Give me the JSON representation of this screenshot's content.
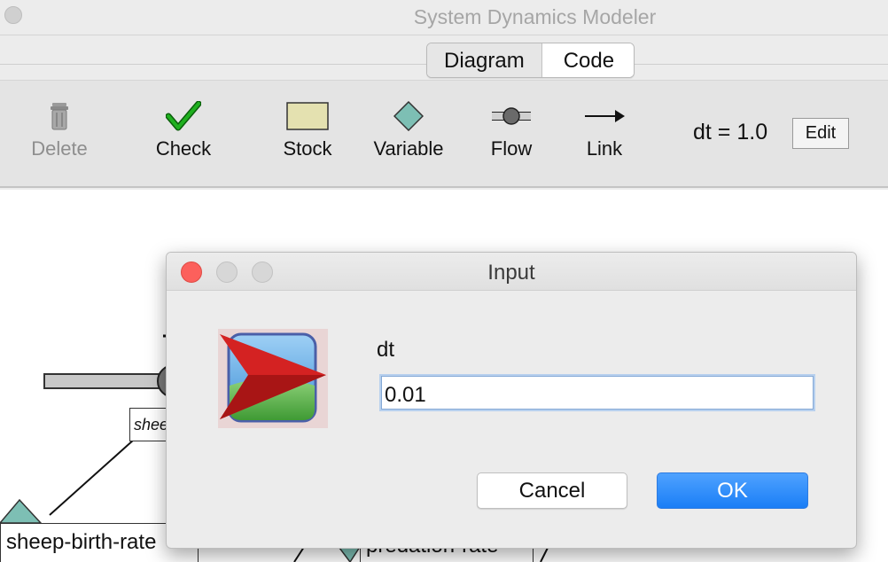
{
  "window": {
    "title": "System Dynamics Modeler"
  },
  "tabs": [
    {
      "label": "Diagram",
      "selected": true
    },
    {
      "label": "Code",
      "selected": false
    }
  ],
  "toolbar": {
    "tools": [
      {
        "label": "Delete",
        "icon": "trash-icon",
        "enabled": false
      },
      {
        "label": "Check",
        "icon": "checkmark-icon",
        "enabled": true
      },
      {
        "label": "Stock",
        "icon": "stock-rectangle-icon",
        "enabled": true
      },
      {
        "label": "Variable",
        "icon": "variable-diamond-icon",
        "enabled": true
      },
      {
        "label": "Flow",
        "icon": "flow-valve-icon",
        "enabled": true
      },
      {
        "label": "Link",
        "icon": "link-arrow-icon",
        "enabled": true
      }
    ],
    "dt_display": "dt = 1.0",
    "edit_label": "Edit"
  },
  "canvas": {
    "labels": {
      "sheep_birth_rate": "sheep-birth-rate",
      "predation_rate": "predation-rate",
      "sheep_small": "sheep"
    }
  },
  "dialog": {
    "title": "Input",
    "icon": "netlogo-app-icon",
    "field_label": "dt",
    "field_value": "0.01",
    "cancel_label": "Cancel",
    "ok_label": "OK"
  },
  "colors": {
    "accent_blue": "#1a7ef6",
    "close_red": "#fc605c",
    "stock_fill": "#e4e1b0",
    "variable_fill": "#7dbfb4",
    "check_green": "#1a9a1a"
  }
}
